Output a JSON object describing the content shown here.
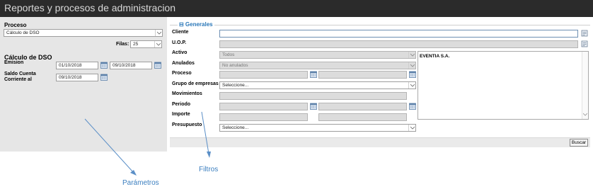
{
  "window": {
    "title": "Reportes y procesos de administracion"
  },
  "params": {
    "proceso_label": "Proceso",
    "proceso_value": "Cálculo de DSO",
    "filas_label": "Filas:",
    "filas_value": "25",
    "section_title": "Cálculo de DSO",
    "emision_label": "Emision",
    "emision_from": "01/10/2018",
    "emision_to": "09/10/2018",
    "saldo_label_1": "Saldo Cuenta",
    "saldo_label_2": "Corriente al",
    "saldo_value": "09/10/2018"
  },
  "filters": {
    "legend": "⊟ Generales",
    "cliente_label": "Cliente",
    "uop_label": "U.O.P.",
    "activo_label": "Activo",
    "activo_value": "Todos",
    "anulados_label": "Anulados",
    "anulados_value": "No anulados",
    "proceso_label": "Proceso",
    "grupo_label": "Grupo de empresas",
    "grupo_value": "Seleccione...",
    "movimientos_label": "Movimientos",
    "periodo_label": "Periodo",
    "importe_label": "Importe",
    "presupuesto_label": "Presupuesto",
    "presupuesto_value": "Seleccione...",
    "list_item": "EVENTIA S.A.",
    "buscar_label": "Buscar"
  },
  "annotations": {
    "parametros": "Parámetros",
    "filtros": "Filtros"
  },
  "colors": {
    "titlebar": "#2b2b2b",
    "panel": "#e6e6e6",
    "accent": "#2a77b8",
    "annotation": "#3a7ebf"
  }
}
